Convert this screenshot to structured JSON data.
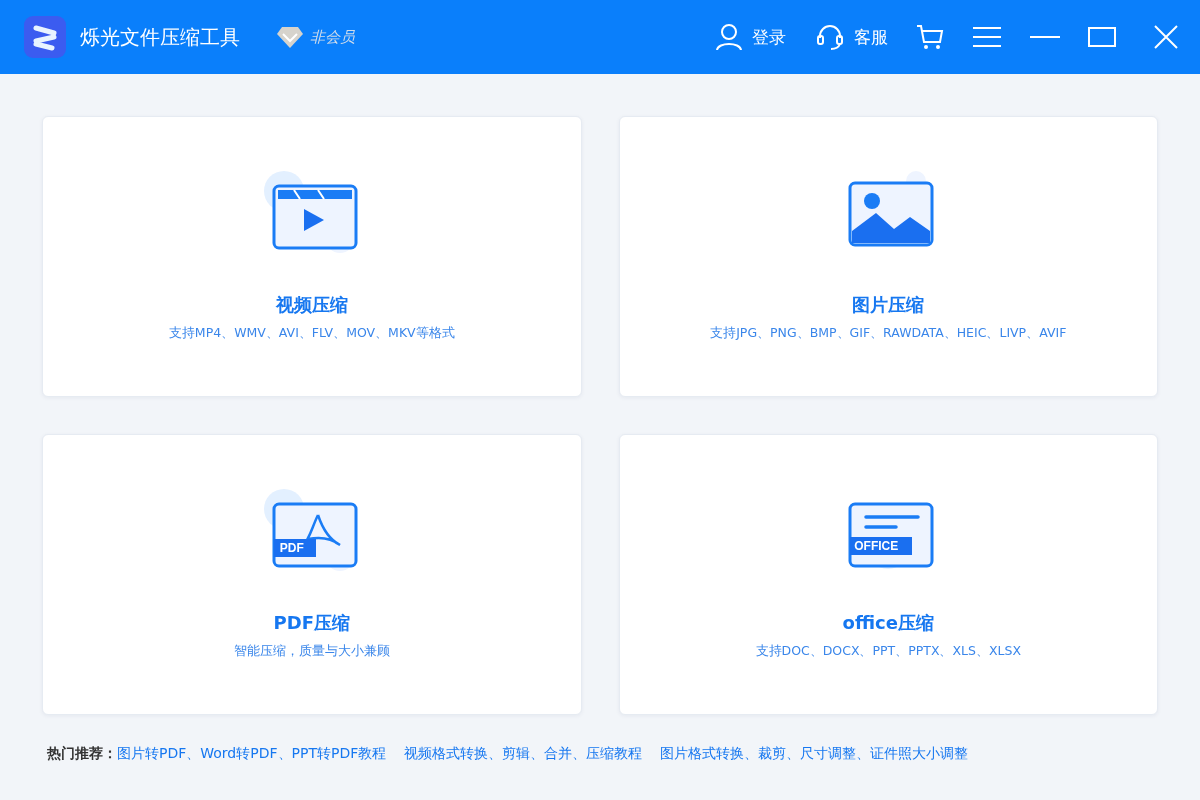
{
  "header": {
    "app_name": "烁光文件压缩工具",
    "member_status": "非会员",
    "login": "登录",
    "service": "客服"
  },
  "cards": [
    {
      "kind": "video",
      "title": "视频压缩",
      "subtitle": "支持MP4、WMV、AVI、FLV、MOV、MKV等格式"
    },
    {
      "kind": "image",
      "title": "图片压缩",
      "subtitle": "支持JPG、PNG、BMP、GIF、RAWDATA、HEIC、LIVP、AVIF"
    },
    {
      "kind": "pdf",
      "title": "PDF压缩",
      "subtitle": "智能压缩，质量与大小兼顾",
      "icon_label": "PDF"
    },
    {
      "kind": "office",
      "title": "office压缩",
      "subtitle": "支持DOC、DOCX、PPT、PPTX、XLS、XLSX",
      "icon_label": "OFFICE"
    }
  ],
  "footer": {
    "label": "热门推荐：",
    "links": [
      "图片转PDF、Word转PDF、PPT转PDF教程",
      "视频格式转换、剪辑、合并、压缩教程",
      "图片格式转换、裁剪、尺寸调整、证件照大小调整"
    ]
  }
}
